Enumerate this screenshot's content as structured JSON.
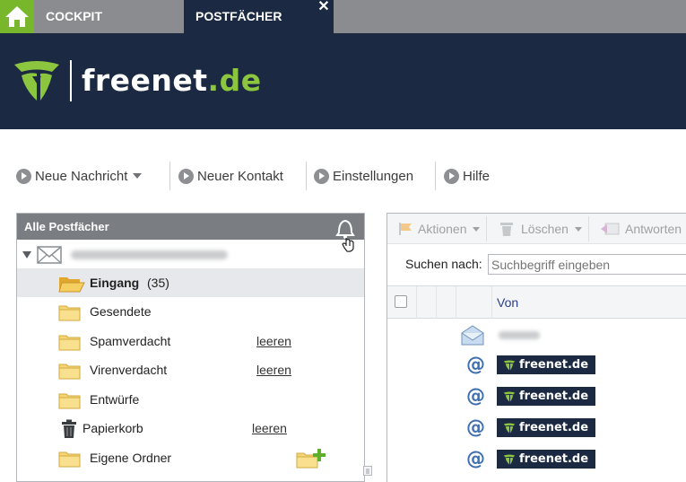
{
  "tabs": {
    "home_icon": "home-icon",
    "cockpit_label": "COCKPIT",
    "postfaecher_label": "POSTFÄCHER",
    "close_label": "✕"
  },
  "brand": {
    "name_part1": "freenet",
    "name_dot": ".",
    "name_part2": "de",
    "accent_color": "#8cc63f",
    "header_color": "#1b2a42"
  },
  "toolbar": {
    "new_message": "Neue Nachricht",
    "new_contact": "Neuer Kontakt",
    "settings": "Einstellungen",
    "help": "Hilfe"
  },
  "folders_panel": {
    "title": "Alle Postfächer",
    "bell_icon": "bell-icon",
    "account_email_blurred": true,
    "folders": [
      {
        "name": "Eingang",
        "count": "(35)",
        "icon": "open-folder-icon",
        "selected": true
      },
      {
        "name": "Gesendete",
        "icon": "folder-icon"
      },
      {
        "name": "Spamverdacht",
        "icon": "folder-icon",
        "action": "leeren"
      },
      {
        "name": "Virenverdacht",
        "icon": "folder-icon",
        "action": "leeren"
      },
      {
        "name": "Entwürfe",
        "icon": "folder-icon"
      },
      {
        "name": "Papierkorb",
        "icon": "trash-icon",
        "action": "leeren"
      },
      {
        "name": "Eigene Ordner",
        "icon": "folder-icon",
        "add_icon": "add-folder-icon"
      }
    ]
  },
  "mail_list": {
    "actions_label": "Aktionen",
    "delete_label": "Löschen",
    "reply_label": "Antworten",
    "search_label": "Suchen nach:",
    "search_placeholder": "Suchbegriff eingeben",
    "column_from": "Von",
    "rows": [
      {
        "icon": "envelope-open-icon",
        "sender_blurred": true
      },
      {
        "icon": "at-sign-icon",
        "sender_badge": "freenet.de"
      },
      {
        "icon": "at-sign-icon",
        "sender_badge": "freenet.de"
      },
      {
        "icon": "at-sign-icon",
        "sender_badge": "freenet.de"
      },
      {
        "icon": "at-sign-icon",
        "sender_badge": "freenet.de"
      }
    ]
  }
}
